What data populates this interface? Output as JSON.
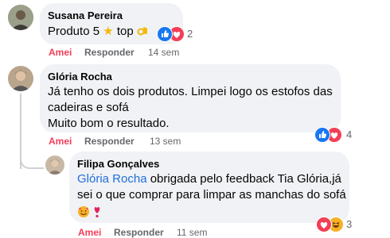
{
  "comments": [
    {
      "author": "Susana Pereira",
      "text": "Produto 5",
      "text_suffix": "top",
      "emoji": [
        "star",
        "ok-hand"
      ],
      "reactions": [
        "like",
        "love"
      ],
      "reaction_count": "2",
      "actions": {
        "like": "Amei",
        "reply": "Responder",
        "time": "14 sem"
      }
    },
    {
      "author": "Glória Rocha",
      "text_lines": [
        "Já tenho os dois produtos. Limpei logo os estofos das",
        "cadeiras e sofá",
        "Muito bom o resultado."
      ],
      "reactions": [
        "like",
        "love"
      ],
      "reaction_count": "4",
      "actions": {
        "like": "Amei",
        "reply": "Responder",
        "time": "13 sem"
      }
    },
    {
      "author": "Filipa Gonçalves",
      "mention": "Glória Rocha",
      "text_first": "obrigada pelo feedback Tia Glória,já",
      "text_second": "sei o que comprar para limpar as manchas do sofá",
      "emoji": [
        "smiling-face-with-hearts",
        "heart-exclamation"
      ],
      "reactions": [
        "love",
        "haha"
      ],
      "reaction_count": "3",
      "actions": {
        "like": "Amei",
        "reply": "Responder",
        "time": "11 sem"
      }
    }
  ],
  "colors": {
    "bubble": "#f0f2f5",
    "link": "#216fdb",
    "liked": "#f33e58",
    "meta": "#65676b"
  }
}
